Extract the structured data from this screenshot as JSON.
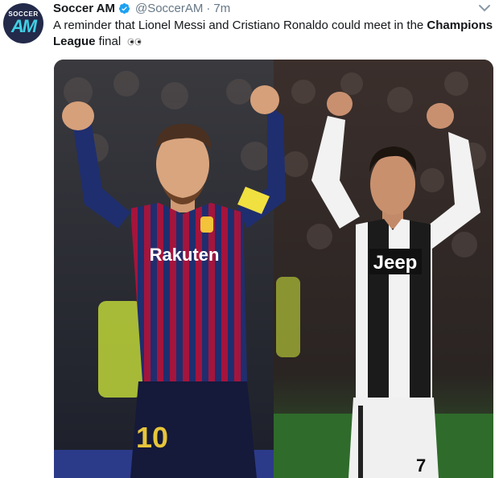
{
  "tweet": {
    "display_name": "Soccer AM",
    "handle": "@SoccerAM",
    "separator": "·",
    "time": "7m",
    "text_part1": "A reminder that Lionel Messi and Cristiano Ronaldo could meet in the ",
    "text_bold": "Champions League",
    "text_part2": " final",
    "avatar_small": "SOCCER",
    "avatar_big": "AM"
  },
  "media": {
    "left_sponsor": "Rakuten",
    "left_number": "10",
    "right_sponsor": "Jeep",
    "right_number": "7"
  },
  "colors": {
    "verified": "#1da1f2",
    "handle": "#657786",
    "avatar_bg": "#232a4a",
    "avatar_accent": "#3fd0e6"
  }
}
